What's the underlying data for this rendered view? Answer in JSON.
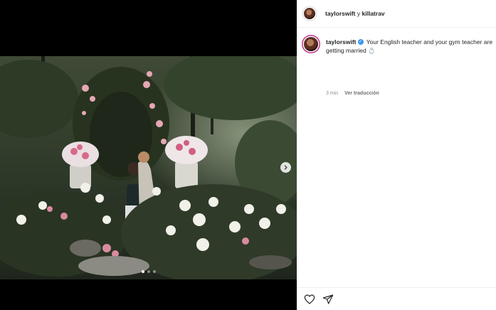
{
  "header": {
    "account": "taylorswift",
    "connector": "y",
    "collaborator": "killatrav"
  },
  "caption": {
    "username": "taylorswift",
    "verified": true,
    "text": "Your English teacher and your gym teacher are getting married",
    "emoji": "💍",
    "time": "3 min",
    "translate_label": "Ver traducción"
  },
  "media": {
    "carousel_count": 3,
    "active_index": 0
  },
  "icons": {
    "header_avatar": "profile-avatar",
    "caption_avatar": "profile-avatar",
    "verified_badge": "verified-badge-icon",
    "next": "chevron-right-icon",
    "like": "heart-icon",
    "share": "paper-plane-icon"
  },
  "colors": {
    "verified": "#3897f0",
    "text": "#262626",
    "muted": "#8e8e8e",
    "story_ring": "#c13584"
  }
}
